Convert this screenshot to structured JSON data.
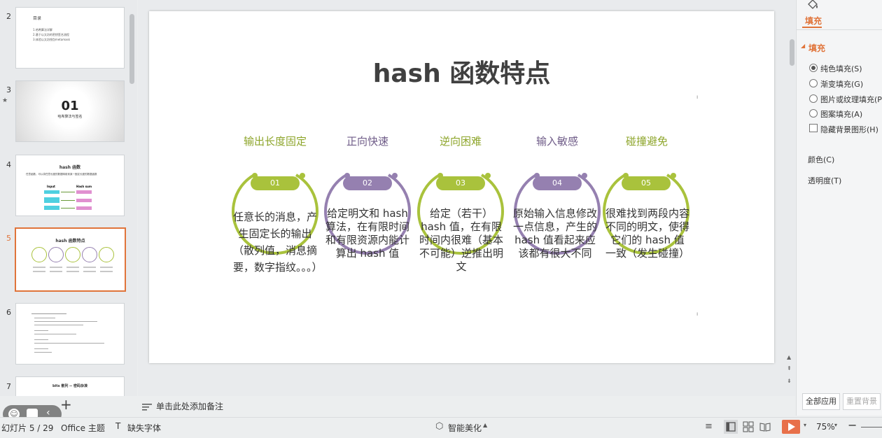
{
  "thumbnails": [
    {
      "num": "2",
      "mark": "",
      "title": "目录",
      "lines": [
        "1.哈希算法详解",
        "2.基于以太坊的密钥签名流程",
        "3.体验以太坊钱包metamask"
      ]
    },
    {
      "num": "3",
      "mark": "★",
      "title": "01",
      "subtitle": "哈希算法与签名"
    },
    {
      "num": "4",
      "title": "hash 函数",
      "text": "任意函数，可以将任意长度的数据映射到某一固定长度的数据函数",
      "col_a": "Input",
      "col_b": "Hash sum"
    },
    {
      "num": "5",
      "title": "hash 函数特点"
    },
    {
      "num": "6"
    },
    {
      "num": "7",
      "title": "bits 散列 -- 密码杂凑"
    }
  ],
  "slide": {
    "title": "hash 函数特点",
    "items": [
      {
        "label": "输出长度固定",
        "num": "01",
        "color": "#a9c23c",
        "desc": "任意长的消息，产生固定长的输出（散列值，消息摘要，数字指纹。。。）"
      },
      {
        "label": "正向快速",
        "num": "02",
        "color": "#9580b0",
        "desc": "给定明文和 hash 算法，在有限时间和有限资源内能计算出 hash 值"
      },
      {
        "label": "逆向困难",
        "num": "03",
        "color": "#a9c23c",
        "desc": "给定（若干）hash 值，在有限时间内很难（基本不可能）逆推出明文"
      },
      {
        "label": "输入敏感",
        "num": "04",
        "color": "#9580b0",
        "desc": "原始输入信息修改一点信息，产生的 hash 值看起来应该都有很大不同"
      },
      {
        "label": "碰撞避免",
        "num": "05",
        "color": "#a9c23c",
        "desc": "很难找到两段内容不同的明文，使得它们的 hash 值一致（发生碰撞）"
      }
    ]
  },
  "notes": {
    "placeholder": "单击此处添加备注"
  },
  "status": {
    "slide_counter": "幻灯片 5 / 29",
    "theme": "Office 主题",
    "missing_font": "缺失字体",
    "beautify": "智能美化",
    "zoom": "75%"
  },
  "right_panel": {
    "tab": "填充",
    "section": "填充",
    "options": [
      "纯色填充(S)",
      "渐变填充(G)",
      "图片或纹理填充(P)",
      "图案填充(A)"
    ],
    "hide_bg": "隐藏背景图形(H)",
    "color_label": "颜色(C)",
    "transparency_label": "透明度(T)",
    "apply_all": "全部应用",
    "reset_bg": "重置背景"
  },
  "colors": {
    "accent": "#e0743a",
    "green": "#a9c23c",
    "purple": "#9580b0",
    "play": "#e8704a"
  }
}
